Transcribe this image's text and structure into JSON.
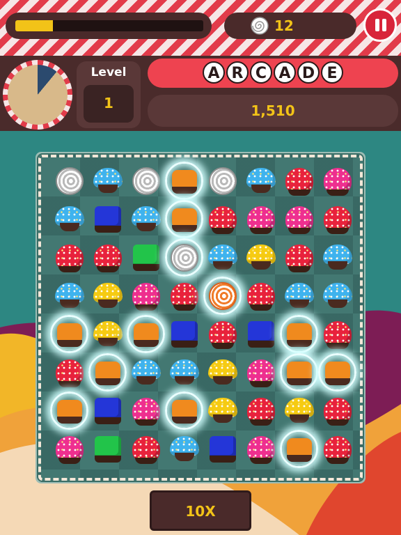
{
  "header": {
    "progress_fraction": 0.2,
    "coins": "12",
    "coin_icon": "swirl-coin-icon",
    "pause_icon": "pause-icon"
  },
  "status": {
    "timer_fraction_remaining": 0.89,
    "level_label": "Level",
    "level_value": "1",
    "mode_letters": [
      "A",
      "R",
      "C",
      "A",
      "D",
      "E"
    ],
    "score": "1,510"
  },
  "board": {
    "rows": [
      [
        "swirl",
        "blue-cupcake",
        "swirl",
        "orange-jelly-glow",
        "swirl",
        "blue-cupcake",
        "red-round",
        "pink-round"
      ],
      [
        "blue-cupcake",
        "blue-square",
        "blue-cupcake",
        "orange-jelly-glow",
        "red-round",
        "pink-round",
        "pink-round",
        "red-round"
      ],
      [
        "red-round",
        "red-round",
        "green-square",
        "swirl-glow",
        "blue-cupcake",
        "yellow-cupcake",
        "red-round",
        "blue-cupcake"
      ],
      [
        "blue-cupcake",
        "yellow-cupcake",
        "pink-round",
        "red-round",
        "orange-swirl-glow",
        "red-round",
        "blue-cupcake",
        "blue-cupcake"
      ],
      [
        "orange-jelly-glow",
        "yellow-cupcake",
        "orange-jelly-glow",
        "blue-square",
        "red-round",
        "blue-square",
        "orange-jelly-glow",
        "red-round"
      ],
      [
        "red-round",
        "orange-jelly-glow",
        "blue-cupcake",
        "blue-cupcake",
        "yellow-cupcake",
        "pink-round",
        "orange-jelly-glow",
        "orange-jelly-glow"
      ],
      [
        "orange-jelly-glow",
        "blue-square",
        "pink-round",
        "orange-jelly-glow",
        "yellow-cupcake",
        "red-round",
        "yellow-cupcake",
        "red-round"
      ],
      [
        "pink-round",
        "green-square",
        "red-round",
        "blue-cupcake",
        "blue-square",
        "pink-round",
        "orange-jelly-glow",
        "red-round"
      ]
    ]
  },
  "footer": {
    "multiplier": "10X"
  },
  "colors": {
    "red": "#e8223c",
    "pink": "#ee2f8f",
    "blue": "#3fb3ee",
    "blue_square": "#2436d8",
    "green": "#22c44a",
    "yellow": "#f6cb12",
    "orange": "#f08a1e",
    "accent_red": "#ee4350",
    "panel_brown": "#4a2b2b",
    "gold_text": "#f2c318"
  }
}
